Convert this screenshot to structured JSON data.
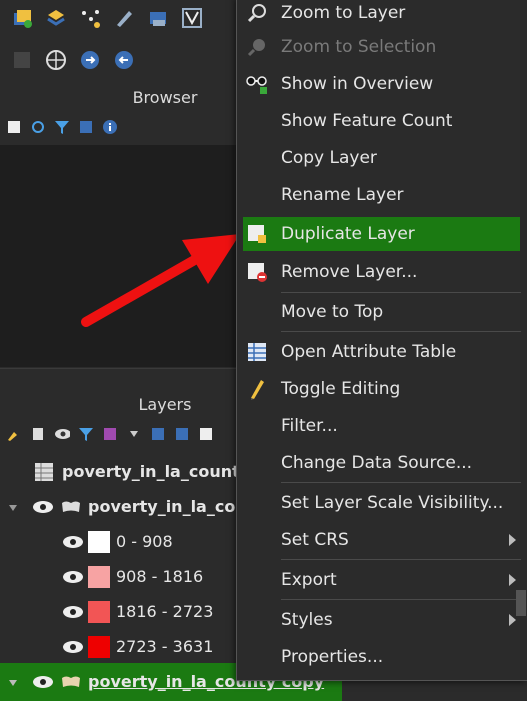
{
  "browser": {
    "title": "Browser"
  },
  "layers_panel": {
    "title": "Layers",
    "items": [
      {
        "label": "poverty_in_la_county"
      },
      {
        "label": "poverty_in_la_cou"
      },
      {
        "label": "poverty_in_la_county copy"
      }
    ],
    "legend": [
      {
        "label": "0 - 908",
        "color": "#ffffff"
      },
      {
        "label": "908 - 1816",
        "color": "#f7a3a3"
      },
      {
        "label": "1816 - 2723",
        "color": "#f25555"
      },
      {
        "label": "2723 - 3631",
        "color": "#ee0000"
      }
    ]
  },
  "context_menu": {
    "zoom_to_layer": "Zoom to Layer",
    "zoom_to_selection": "Zoom to Selection",
    "show_in_overview": "Show in Overview",
    "show_feature_count": "Show Feature Count",
    "copy_layer": "Copy Layer",
    "rename_layer": "Rename Layer",
    "duplicate_layer": "Duplicate Layer",
    "remove_layer": "Remove Layer...",
    "move_to_top": "Move to Top",
    "open_attribute_table": "Open Attribute Table",
    "toggle_editing": "Toggle Editing",
    "filter": "Filter...",
    "change_data_source": "Change Data Source...",
    "set_layer_scale_visibility": "Set Layer Scale Visibility...",
    "set_crs": "Set CRS",
    "export": "Export",
    "styles": "Styles",
    "properties": "Properties..."
  },
  "colors": {
    "highlight": "#1b7a12",
    "annotation_arrow": "#ee1111"
  }
}
